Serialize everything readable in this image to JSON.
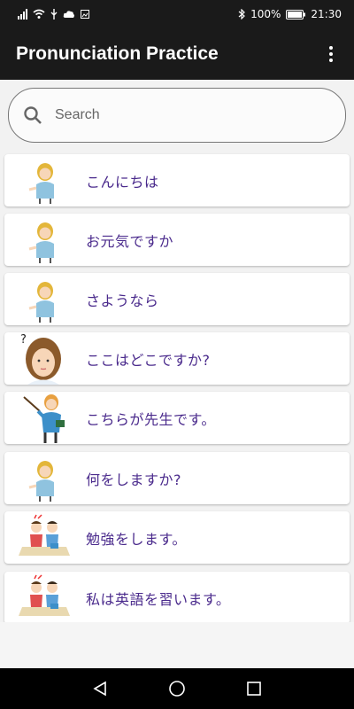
{
  "status": {
    "battery": "100%",
    "time": "21:30"
  },
  "app": {
    "title": "Pronunciation Practice",
    "menu_icon": "more-vert-icon"
  },
  "search": {
    "placeholder": "Search",
    "icon": "search-icon"
  },
  "phrases": [
    {
      "text": "こんにちは",
      "image": "woman-presenting-illustration"
    },
    {
      "text": "お元気ですか",
      "image": "woman-presenting-illustration"
    },
    {
      "text": "さようなら",
      "image": "woman-presenting-illustration"
    },
    {
      "text": "ここはどこですか?",
      "image": "woman-question-illustration"
    },
    {
      "text": "こちらが先生です。",
      "image": "teacher-pointer-illustration"
    },
    {
      "text": "何をしますか?",
      "image": "woman-presenting-illustration"
    },
    {
      "text": "勉強をします。",
      "image": "students-studying-illustration"
    },
    {
      "text": "私は英語を習います。",
      "image": "students-studying-illustration"
    }
  ],
  "nav": {
    "back_icon": "back-triangle-icon",
    "home_icon": "home-circle-icon",
    "recents_icon": "recents-square-icon"
  },
  "colors": {
    "app_bar": "#1a1a1a",
    "phrase_text": "#4a2a8c",
    "background": "#f2f2f2"
  }
}
